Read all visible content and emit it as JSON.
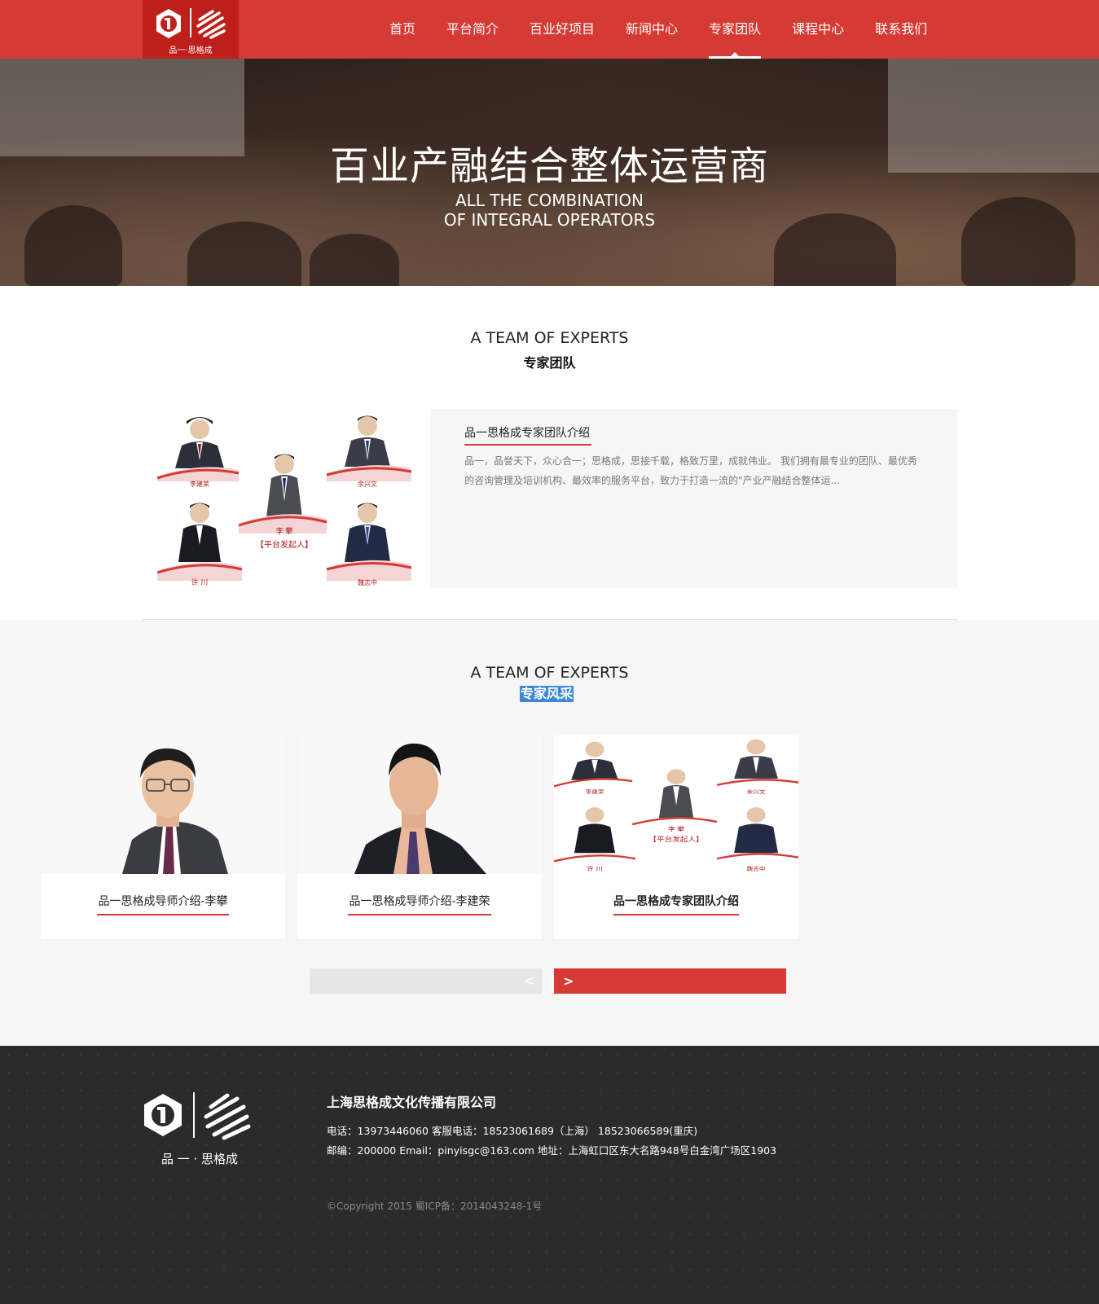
{
  "header": {
    "logo_text": "品一·思格成",
    "nav": [
      "首页",
      "平台简介",
      "百业好项目",
      "新闻中心",
      "专家团队",
      "课程中心",
      "联系我们"
    ],
    "active_nav": "专家团队"
  },
  "banner": {
    "title": "百业产融结合整体运营商",
    "subtitle_line1": "ALL THE COMBINATION",
    "subtitle_line2": "OF INTEGRAL OPERATORS"
  },
  "team_section": {
    "title_en": "A TEAM OF EXPERTS",
    "title_cn": "专家团队",
    "photo_names": [
      "李建荣",
      "余兴文",
      "李 攀",
      "【平台发起人】",
      "许 川",
      "魏志中"
    ],
    "intro_title": "品一思格成专家团队介绍",
    "intro_text": "品一，品誉天下，众心合一；思格成，思接千载，格致万里，成就伟业。 我们拥有最专业的团队、最优秀的咨询管理及培训机构、最效率的服务平台，致力于打造一流的\"产业产融结合整体运..."
  },
  "style_section": {
    "title_en": "A TEAM OF EXPERTS",
    "title_cn": "专家风采",
    "cards": [
      {
        "caption": "品一思格成导师介绍-李攀"
      },
      {
        "caption": "品一思格成导师介绍-李建荣"
      },
      {
        "caption": "品一思格成专家团队介绍"
      }
    ],
    "prev_label": "<",
    "next_label": ">"
  },
  "footer": {
    "logo_text": "品 一 · 思格成",
    "company": "上海思格成文化传播有限公司",
    "contact_line1": "电话：13973446060    客服电话：18523061689（上海）   18523066589(重庆)",
    "contact_line2": "邮编：200000   Email：pinyisgc@163.com    地址：上海虹口区东大名路948号白金湾广场区1903",
    "copyright": "©Copyright 2015 蜀ICP备：2014043248-1号"
  },
  "colors": {
    "brand_red": "#d63a34",
    "dark_red": "#bf1f1a",
    "footer_bg": "#2b2b2b",
    "highlight_blue": "#3e88d8",
    "light_gray": "#f6f6f6"
  }
}
